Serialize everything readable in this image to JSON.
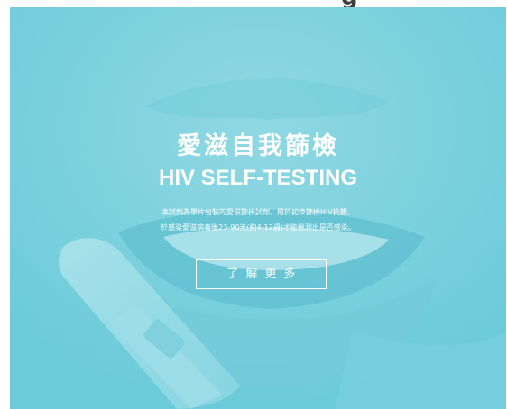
{
  "header": {
    "partial_heading": "g"
  },
  "hero": {
    "title_zh": "愛滋自我篩檢",
    "title_en": "HIV SELF-TESTING",
    "description": [
      "本試劑為單片包裝的愛滋篩檢試劑，用於初步篩檢HIV抗體，",
      "於感染愛滋病毒後23-90天(約4-12週)才能檢測出是否感染。"
    ],
    "cta_label": "了解更多"
  },
  "colors": {
    "overlay": "#6ccbd9",
    "text": "#ffffff"
  }
}
